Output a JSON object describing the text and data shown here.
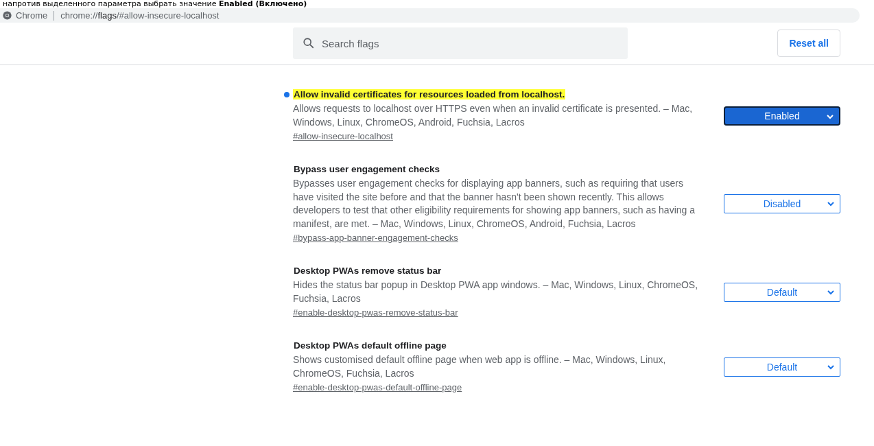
{
  "caption": "напротив выделенного параметра выбрать значение **Enabled (Включено)**",
  "address_bar": {
    "site": "Chrome",
    "url_prefix": "chrome://",
    "url_bold": "flags",
    "url_rest": "/#allow-insecure-localhost"
  },
  "search": {
    "placeholder": "Search flags"
  },
  "reset_button": "Reset all",
  "flags": [
    {
      "title": "Allow invalid certificates for resources loaded from localhost.",
      "highlighted": true,
      "modified": true,
      "description": "Allows requests to localhost over HTTPS even when an invalid certificate is presented. – Mac, Windows, Linux, ChromeOS, Android, Fuchsia, Lacros",
      "link": "#allow-insecure-localhost",
      "value": "Enabled"
    },
    {
      "title": "Bypass user engagement checks",
      "highlighted": false,
      "modified": false,
      "description": "Bypasses user engagement checks for displaying app banners, such as requiring that users have visited the site before and that the banner hasn't been shown recently. This allows developers to test that other eligibility requirements for showing app banners, such as having a manifest, are met. – Mac, Windows, Linux, ChromeOS, Android, Fuchsia, Lacros",
      "link": "#bypass-app-banner-engagement-checks",
      "value": "Disabled"
    },
    {
      "title": "Desktop PWAs remove status bar",
      "highlighted": false,
      "modified": false,
      "description": "Hides the status bar popup in Desktop PWA app windows. – Mac, Windows, Linux, ChromeOS, Fuchsia, Lacros",
      "link": "#enable-desktop-pwas-remove-status-bar",
      "value": "Default"
    },
    {
      "title": "Desktop PWAs default offline page",
      "highlighted": false,
      "modified": false,
      "description": "Shows customised default offline page when web app is offline. – Mac, Windows, Linux, ChromeOS, Fuchsia, Lacros",
      "link": "#enable-desktop-pwas-default-offline-page",
      "value": "Default"
    }
  ]
}
